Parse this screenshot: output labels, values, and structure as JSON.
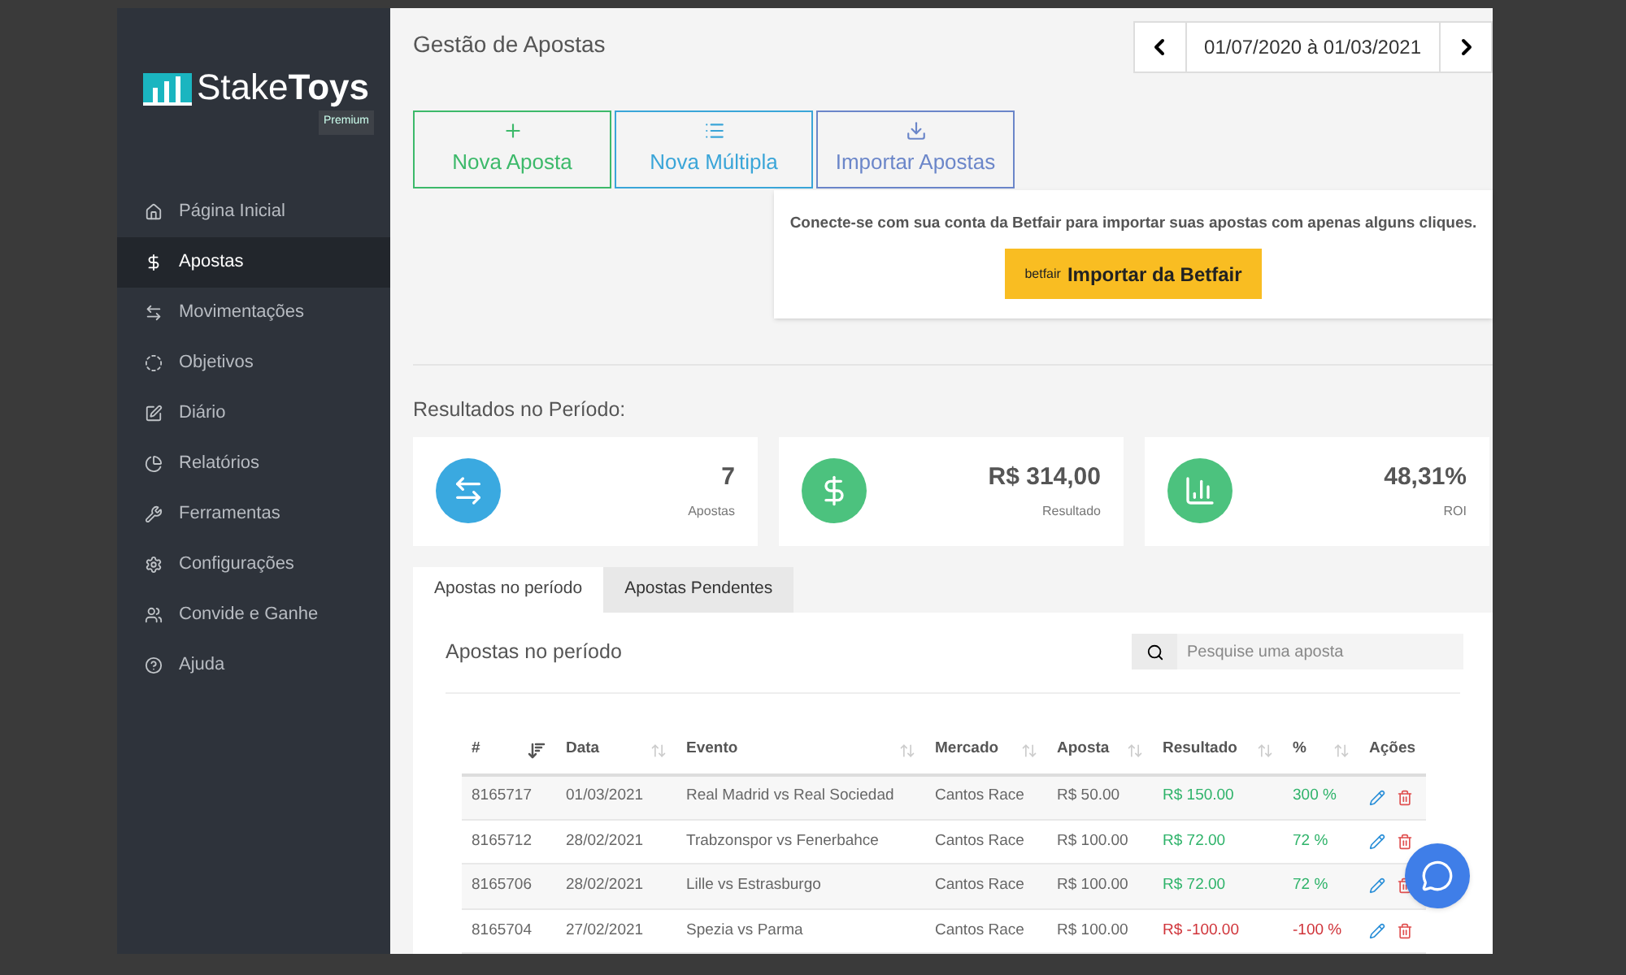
{
  "sidebar": {
    "logo": {
      "light": "Stake",
      "bold": "Toys",
      "badge": "Premium"
    },
    "items": [
      {
        "label": "Página Inicial",
        "selected": false
      },
      {
        "label": "Apostas",
        "selected": true
      },
      {
        "label": "Movimentações",
        "selected": false
      },
      {
        "label": "Objetivos",
        "selected": false
      },
      {
        "label": "Diário",
        "selected": false
      },
      {
        "label": "Relatórios",
        "selected": false
      },
      {
        "label": "Ferramentas",
        "selected": false
      },
      {
        "label": "Configurações",
        "selected": false
      },
      {
        "label": "Convide e Ganhe",
        "selected": false
      },
      {
        "label": "Ajuda",
        "selected": false
      }
    ]
  },
  "header": {
    "title": "Gestão de Apostas",
    "date_range": "01/07/2020 à 01/03/2021"
  },
  "actions": [
    {
      "label": "Nova Aposta",
      "color": "#3cb96a"
    },
    {
      "label": "Nova Múltipla",
      "color": "#3aa5d8"
    },
    {
      "label": "Importar Apostas",
      "color": "#6b86c9"
    }
  ],
  "betfair": {
    "message": "Conecte-se com sua conta da Betfair para importar suas apostas com apenas alguns cliques.",
    "brand": "betfair",
    "button": "Importar da Betfair"
  },
  "results": {
    "title": "Resultados no Período:",
    "cards": [
      {
        "value": "7",
        "label": "Apostas",
        "color": "#3aa9e0"
      },
      {
        "value": "R$ 314,00",
        "label": "Resultado",
        "color": "#4cc27e"
      },
      {
        "value": "48,31%",
        "label": "ROI",
        "color": "#4cc27e"
      }
    ]
  },
  "tabs": [
    {
      "label": "Apostas no período",
      "selected": true
    },
    {
      "label": "Apostas Pendentes",
      "selected": false
    }
  ],
  "table": {
    "title": "Apostas no período",
    "search_placeholder": "Pesquise uma aposta",
    "columns": [
      {
        "label": "#",
        "sorted": true
      },
      {
        "label": "Data",
        "sorted": false
      },
      {
        "label": "Evento",
        "sorted": false
      },
      {
        "label": "Mercado",
        "sorted": false
      },
      {
        "label": "Aposta",
        "sorted": false
      },
      {
        "label": "Resultado",
        "sorted": false
      },
      {
        "label": "%",
        "sorted": false
      },
      {
        "label": "Ações"
      }
    ],
    "rows": [
      {
        "id": "8165717",
        "date": "01/03/2021",
        "event": "Real Madrid vs Real Sociedad",
        "market": "Cantos Race",
        "stake": "R$ 50.00",
        "result": "R$ 150.00",
        "percent": "300 %",
        "color": "#2fb36a"
      },
      {
        "id": "8165712",
        "date": "28/02/2021",
        "event": "Trabzonspor vs Fenerbahce",
        "market": "Cantos Race",
        "stake": "R$ 100.00",
        "result": "R$ 72.00",
        "percent": "72 %",
        "color": "#2fb36a"
      },
      {
        "id": "8165706",
        "date": "28/02/2021",
        "event": "Lille vs Estrasburgo",
        "market": "Cantos Race",
        "stake": "R$ 100.00",
        "result": "R$ 72.00",
        "percent": "72 %",
        "color": "#2fb36a"
      },
      {
        "id": "8165704",
        "date": "27/02/2021",
        "event": "Spezia vs Parma",
        "market": "Cantos Race",
        "stake": "R$ 100.00",
        "result": "R$ -100.00",
        "percent": "-100 %",
        "color": "#d0343a"
      }
    ]
  }
}
